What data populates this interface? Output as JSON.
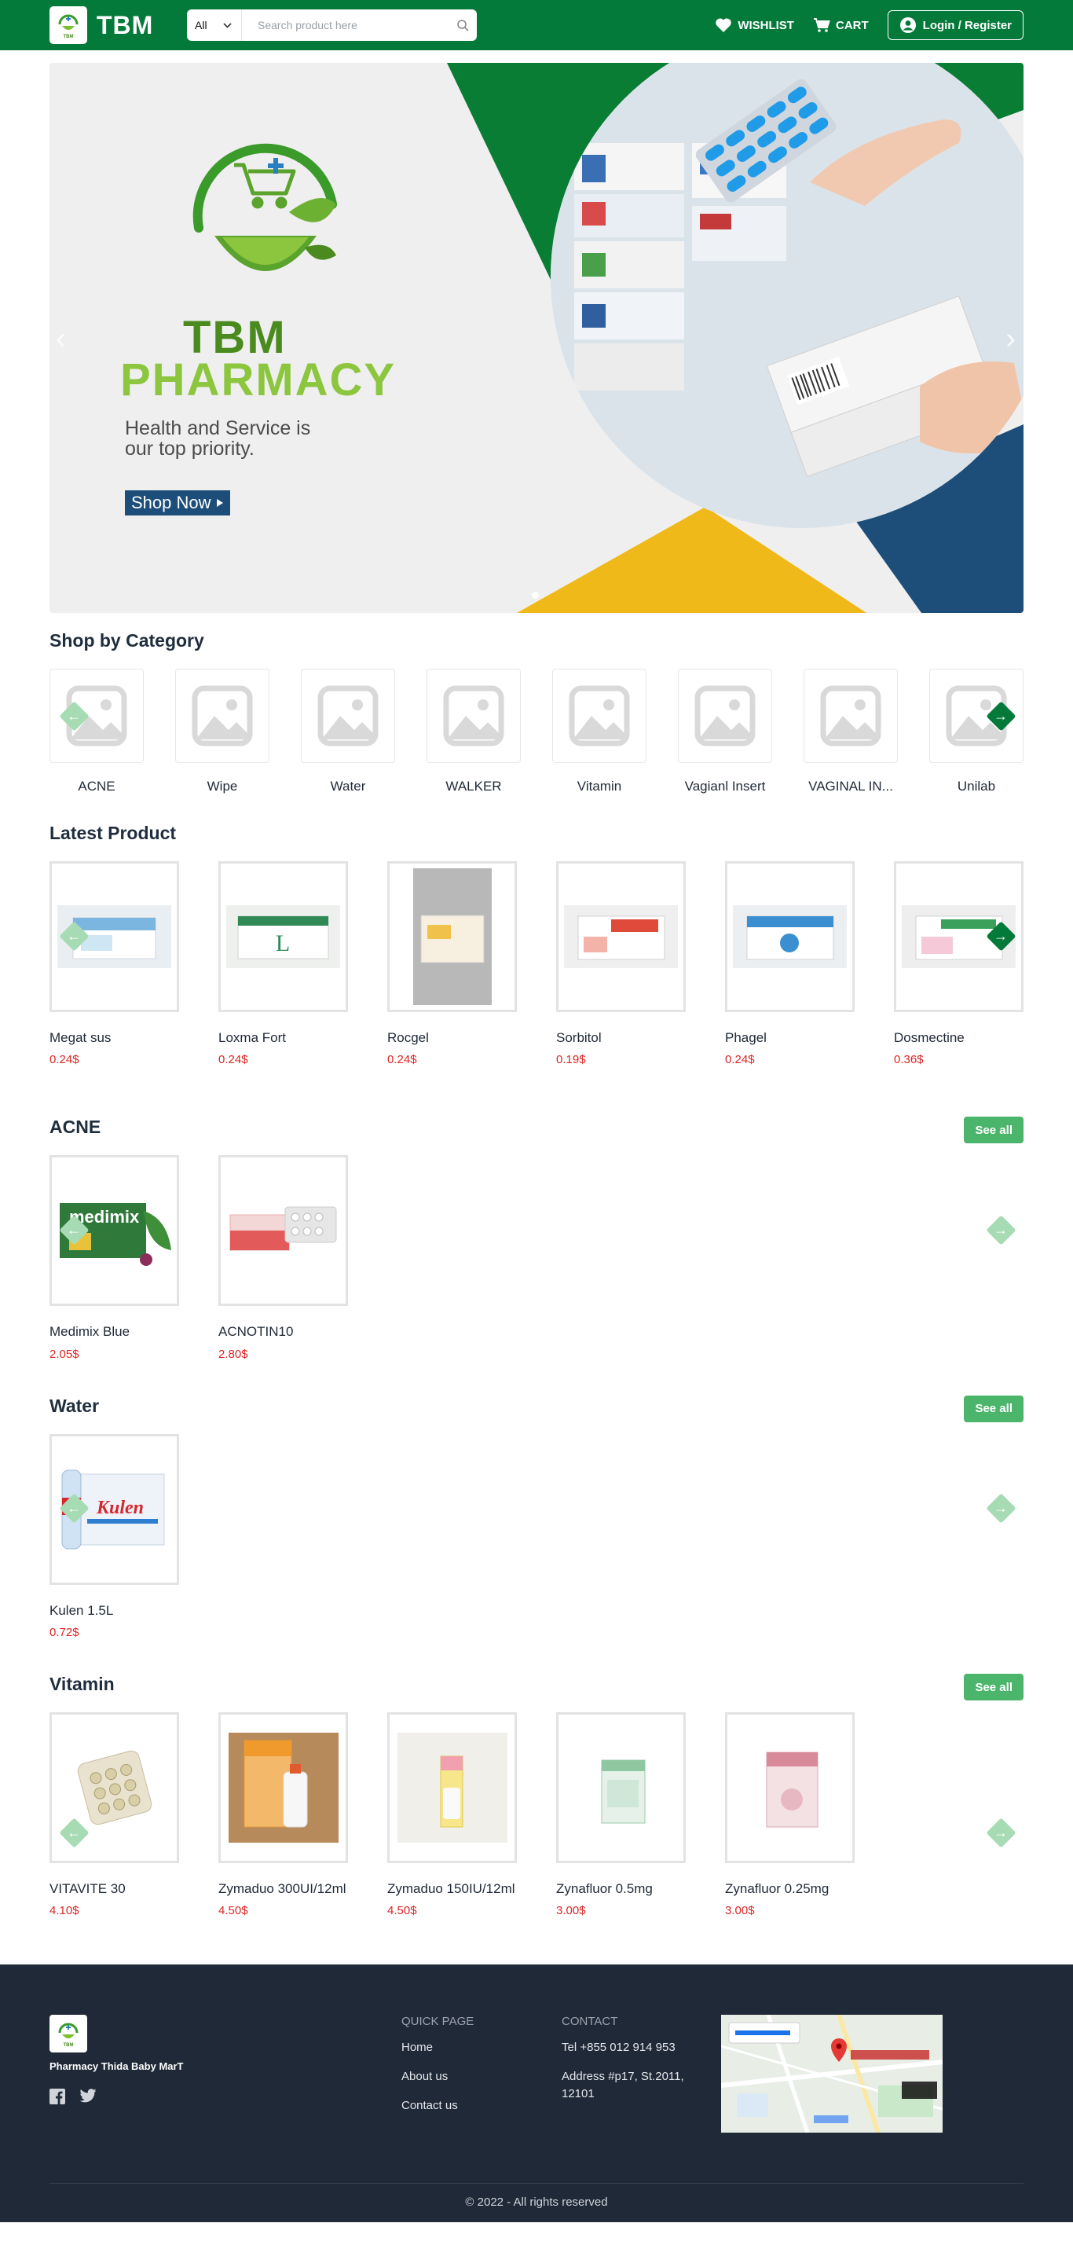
{
  "brand": {
    "name": "TBM",
    "logo_text": "TBM"
  },
  "search": {
    "category": "All",
    "placeholder": "Search product here"
  },
  "nav": {
    "wishlist": "WISHLIST",
    "cart": "CART",
    "login": "Login / Register"
  },
  "hero": {
    "title_line1": "TBM",
    "title_line2": "PHARMACY",
    "tagline": "Health and Service is our top priority.",
    "cta": "Shop Now"
  },
  "categories": {
    "title": "Shop by Category",
    "items": [
      "ACNE",
      "Wipe",
      "Water",
      "WALKER",
      "Vitamin",
      "Vagianl Insert",
      "VAGINAL IN...",
      "Unilab"
    ]
  },
  "latest": {
    "title": "Latest Product",
    "items": [
      {
        "name": "Megat sus",
        "price": "0.24$"
      },
      {
        "name": "Loxma Fort",
        "price": "0.24$"
      },
      {
        "name": "Rocgel",
        "price": "0.24$"
      },
      {
        "name": "Sorbitol",
        "price": "0.19$"
      },
      {
        "name": "Phagel",
        "price": "0.24$"
      },
      {
        "name": "Dosmectine",
        "price": "0.36$"
      }
    ]
  },
  "sections": [
    {
      "title": "ACNE",
      "see_all": "See all",
      "items": [
        {
          "name": "Medimix Blue",
          "price": "2.05$"
        },
        {
          "name": "ACNOTIN10",
          "price": "2.80$"
        }
      ]
    },
    {
      "title": "Water",
      "see_all": "See all",
      "items": [
        {
          "name": "Kulen 1.5L",
          "price": "0.72$"
        }
      ]
    },
    {
      "title": "Vitamin",
      "see_all": "See all",
      "items": [
        {
          "name": "VITAVITE 30",
          "price": "4.10$"
        },
        {
          "name": "Zymaduo 300UI/12ml",
          "price": "4.50$"
        },
        {
          "name": "Zymaduo 150IU/12ml",
          "price": "4.50$"
        },
        {
          "name": "Zynafluor 0.5mg",
          "price": "3.00$"
        },
        {
          "name": "Zynafluor 0.25mg",
          "price": "3.00$"
        }
      ]
    }
  ],
  "footer": {
    "brand": "Pharmacy Thida Baby MarT",
    "quick_title": "QUICK PAGE",
    "quick_links": [
      "Home",
      "About us",
      "Contact us"
    ],
    "contact_title": "CONTACT",
    "tel": "Tel +855 012 914 953",
    "address": "Address #p17, St.2011, 12101",
    "copyright": "© 2022 - All rights reserved"
  },
  "colors": {
    "primary": "#047a3a",
    "accent": "#4cb56c",
    "price": "#dc2626",
    "footer": "#1f2937"
  }
}
